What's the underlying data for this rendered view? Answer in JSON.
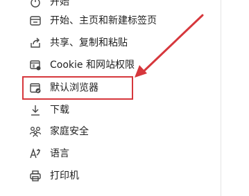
{
  "menu": {
    "items": [
      {
        "label": "开始",
        "icon": "power-icon"
      },
      {
        "label": "开始、主页和新建标签页",
        "icon": "home-tab-icon"
      },
      {
        "label": "共享、复制和粘贴",
        "icon": "share-icon"
      },
      {
        "label": "Cookie 和网站权限",
        "icon": "cookie-permissions-icon"
      },
      {
        "label": "默认浏览器",
        "icon": "default-browser-icon"
      },
      {
        "label": "下载",
        "icon": "download-icon"
      },
      {
        "label": "家庭安全",
        "icon": "family-safety-icon"
      },
      {
        "label": "语言",
        "icon": "language-icon"
      },
      {
        "label": "打印机",
        "icon": "printer-icon"
      }
    ]
  },
  "annotation": {
    "highlighted_item": "默认浏览器",
    "color": "#d6373c"
  }
}
